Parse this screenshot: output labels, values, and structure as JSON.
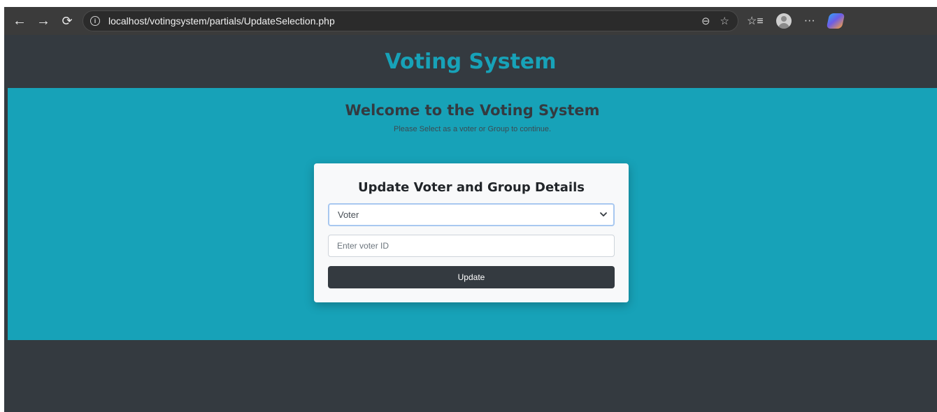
{
  "browser": {
    "url": "localhost/votingsystem/partials/UpdateSelection.php",
    "icons": [
      "back-arrow-icon",
      "forward-arrow-icon",
      "reload-icon",
      "info-icon",
      "zoom-icon",
      "star-icon",
      "favorites-icon",
      "profile-icon",
      "more-icon",
      "copilot-icon"
    ]
  },
  "header": {
    "title": "Voting System"
  },
  "hero": {
    "heading": "Welcome to the Voting System",
    "subheading": "Please Select as a voter or Group to continue."
  },
  "form": {
    "title": "Update Voter and Group Details",
    "select_value": "Voter",
    "input_placeholder": "Enter voter ID",
    "button_label": "Update"
  },
  "colors": {
    "page_dark": "#343a40",
    "accent_teal": "#17a2b8",
    "card_bg": "#f8f9fa"
  }
}
